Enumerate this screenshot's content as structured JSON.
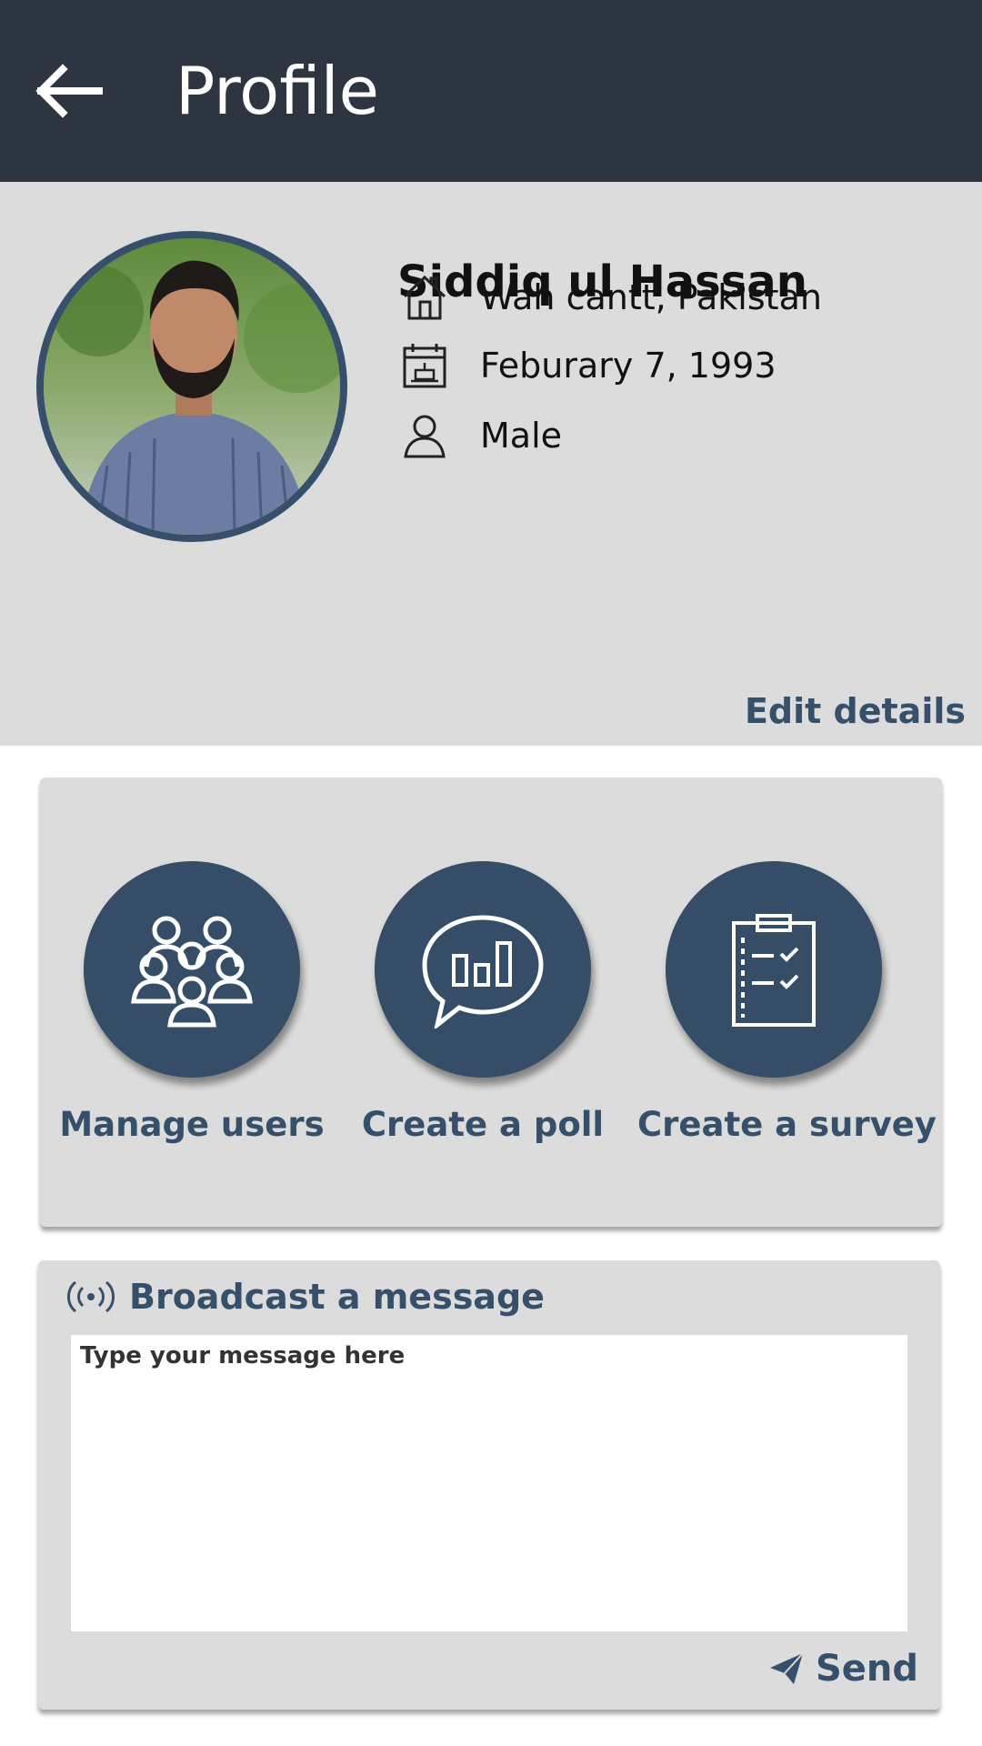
{
  "header": {
    "title": "Profile",
    "back_icon": "arrow-left-icon"
  },
  "profile": {
    "name": "Siddiq ul Hassan",
    "location": "Wah cantt, Pakistan",
    "birthday": "Feburary 7, 1993",
    "gender": "Male",
    "edit_label": "Edit details",
    "icons": [
      "home-icon",
      "calendar-icon",
      "user-icon"
    ]
  },
  "actions": [
    {
      "label": "Manage users",
      "icon": "users-group-icon"
    },
    {
      "label": "Create a poll",
      "icon": "poll-chat-icon"
    },
    {
      "label": "Create a survey",
      "icon": "clipboard-checklist-icon"
    }
  ],
  "broadcast": {
    "title": "Broadcast a message",
    "placeholder": "Type your message here",
    "value": "",
    "send_label": "Send"
  },
  "colors": {
    "header_bg": "#2d3540",
    "accent": "#36506c",
    "panel_bg": "#dcdcdc"
  }
}
